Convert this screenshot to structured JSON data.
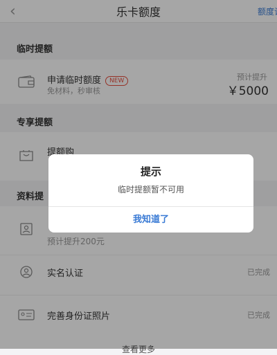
{
  "header": {
    "title": "乐卡额度",
    "right_link": "额度记"
  },
  "temp_section": {
    "title": "临时提额",
    "item": {
      "title": "申请临时额度",
      "badge": "NEW",
      "subtitle": "免材料，秒审核",
      "right_label": "预计提升",
      "right_value": "￥5000"
    }
  },
  "exclusive_section": {
    "title": "专享提额",
    "item": {
      "title": "提额购"
    }
  },
  "data_section": {
    "title_partial": "资料提",
    "items": [
      {
        "title": "",
        "subtitle": "预计提升200元",
        "status": ""
      },
      {
        "title": "实名认证",
        "status": "已完成"
      },
      {
        "title": "完善身份证照片",
        "status": "已完成"
      }
    ]
  },
  "bottom": {
    "more": "查看更多"
  },
  "dialog": {
    "title": "提示",
    "message": "临时提额暂不可用",
    "button": "我知道了"
  },
  "colors": {
    "accent": "#3a7bd5",
    "badge": "#e74c3c"
  },
  "icons": {
    "back": "chevron-left-icon",
    "wallet": "wallet-icon",
    "bag": "shopping-bag-icon",
    "id_card": "id-card-icon",
    "person": "person-icon"
  }
}
